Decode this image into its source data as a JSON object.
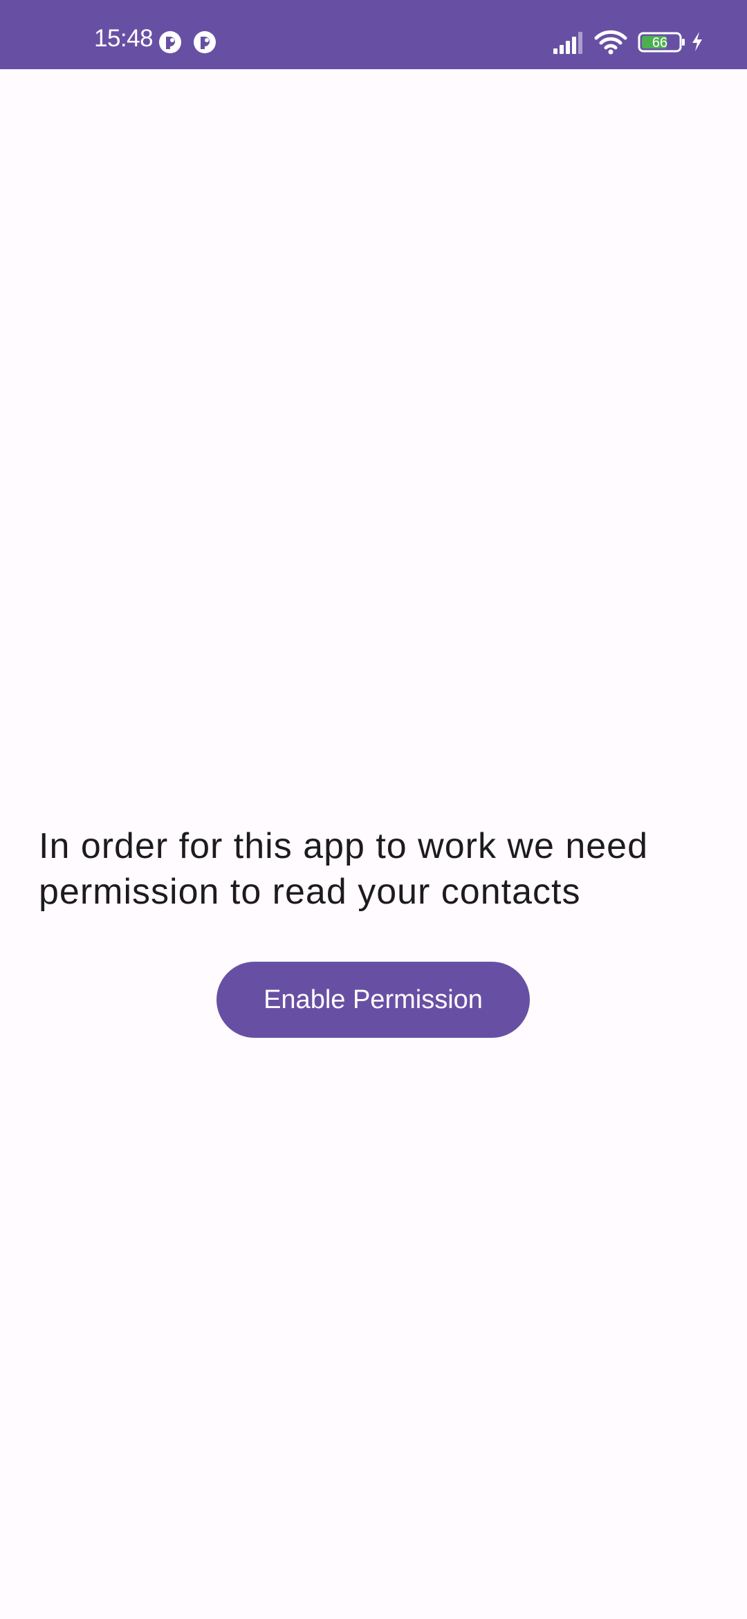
{
  "status_bar": {
    "time": "15:48",
    "notification_icons": [
      "app-notification-icon",
      "app-notification-icon"
    ],
    "signal_icon": "cellular-signal-icon",
    "wifi_icon": "wifi-icon",
    "battery_level": "66",
    "charging_icon": "charging-bolt-icon",
    "background_color": "#6750A4"
  },
  "main": {
    "message": "In order for this app to work we need permission to read your contacts",
    "button_label": "Enable Permission",
    "accent_color": "#6750A4",
    "background_color": "#FFFBFE",
    "text_color": "#1C1B1F"
  }
}
